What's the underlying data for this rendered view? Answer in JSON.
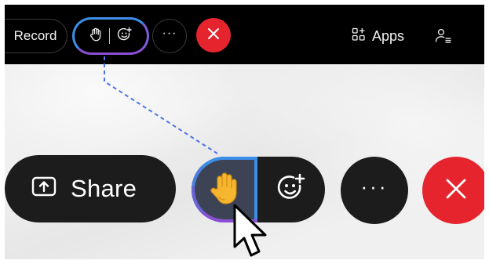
{
  "top_toolbar": {
    "record_label": "Record",
    "raise_hand_icon": "hand-icon",
    "reactions_icon": "smiley-plus-icon",
    "more_label": "···",
    "leave_icon": "close-icon",
    "apps_label": "Apps",
    "apps_icon": "apps-grid-icon",
    "participants_icon": "participants-icon"
  },
  "main_toolbar": {
    "share_label": "Share",
    "share_icon": "share-screen-icon",
    "raise_hand_emoji": "✋",
    "reactions_icon": "smiley-plus-icon",
    "more_label": "···",
    "leave_icon": "close-icon"
  },
  "colors": {
    "toolbar_bg": "#1c1c1c",
    "leave_red": "#e5242e",
    "highlight_blue": "#3b8fe8",
    "highlight_purple": "#8a4fd6",
    "connector_blue": "#4a74e8"
  }
}
